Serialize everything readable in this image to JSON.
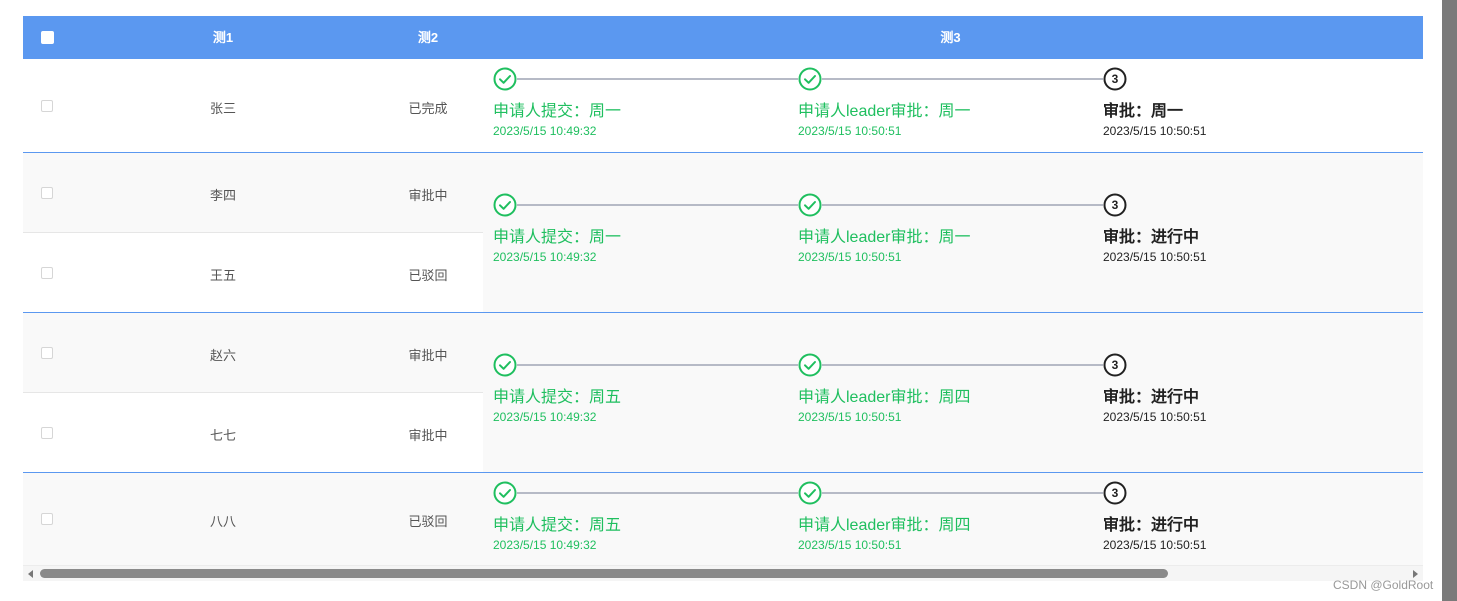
{
  "columns": {
    "c1": "测1",
    "c2": "测2",
    "c3": "测3"
  },
  "groups": [
    {
      "rows": [
        {
          "name": "张三",
          "status": "已完成"
        }
      ],
      "steps": [
        {
          "state": "done",
          "title": "申请人提交：周一",
          "time": "2023/5/15 10:49:32"
        },
        {
          "state": "done",
          "title": "申请人leader审批：周一",
          "time": "2023/5/15 10:50:51"
        },
        {
          "state": "current",
          "num": "3",
          "title": "审批：周一",
          "time": "2023/5/15 10:50:51"
        }
      ]
    },
    {
      "rows": [
        {
          "name": "李四",
          "status": "审批中"
        },
        {
          "name": "王五",
          "status": "已驳回"
        }
      ],
      "steps": [
        {
          "state": "done",
          "title": "申请人提交：周一",
          "time": "2023/5/15 10:49:32"
        },
        {
          "state": "done",
          "title": "申请人leader审批：周一",
          "time": "2023/5/15 10:50:51"
        },
        {
          "state": "current",
          "num": "3",
          "title": "审批：进行中",
          "time": "2023/5/15 10:50:51"
        }
      ]
    },
    {
      "rows": [
        {
          "name": "赵六",
          "status": "审批中"
        },
        {
          "name": "七七",
          "status": "审批中"
        }
      ],
      "steps": [
        {
          "state": "done",
          "title": "申请人提交：周五",
          "time": "2023/5/15 10:49:32"
        },
        {
          "state": "done",
          "title": "申请人leader审批：周四",
          "time": "2023/5/15 10:50:51"
        },
        {
          "state": "current",
          "num": "3",
          "title": "审批：进行中",
          "time": "2023/5/15 10:50:51"
        }
      ]
    },
    {
      "rows": [
        {
          "name": "八八",
          "status": "已驳回"
        }
      ],
      "steps": [
        {
          "state": "done",
          "title": "申请人提交：周五",
          "time": "2023/5/15 10:49:32"
        },
        {
          "state": "done",
          "title": "申请人leader审批：周四",
          "time": "2023/5/15 10:50:51"
        },
        {
          "state": "current",
          "num": "3",
          "title": "审批：进行中",
          "time": "2023/5/15 10:50:51"
        }
      ]
    }
  ],
  "colors": {
    "header": "#5b98f0",
    "done": "#1fbf5f",
    "current": "#222222",
    "connector": "#b6bac6"
  },
  "icons": {
    "done": "check-circle-icon",
    "current": "step-number-icon"
  },
  "watermark": "CSDN @GoldRoot"
}
